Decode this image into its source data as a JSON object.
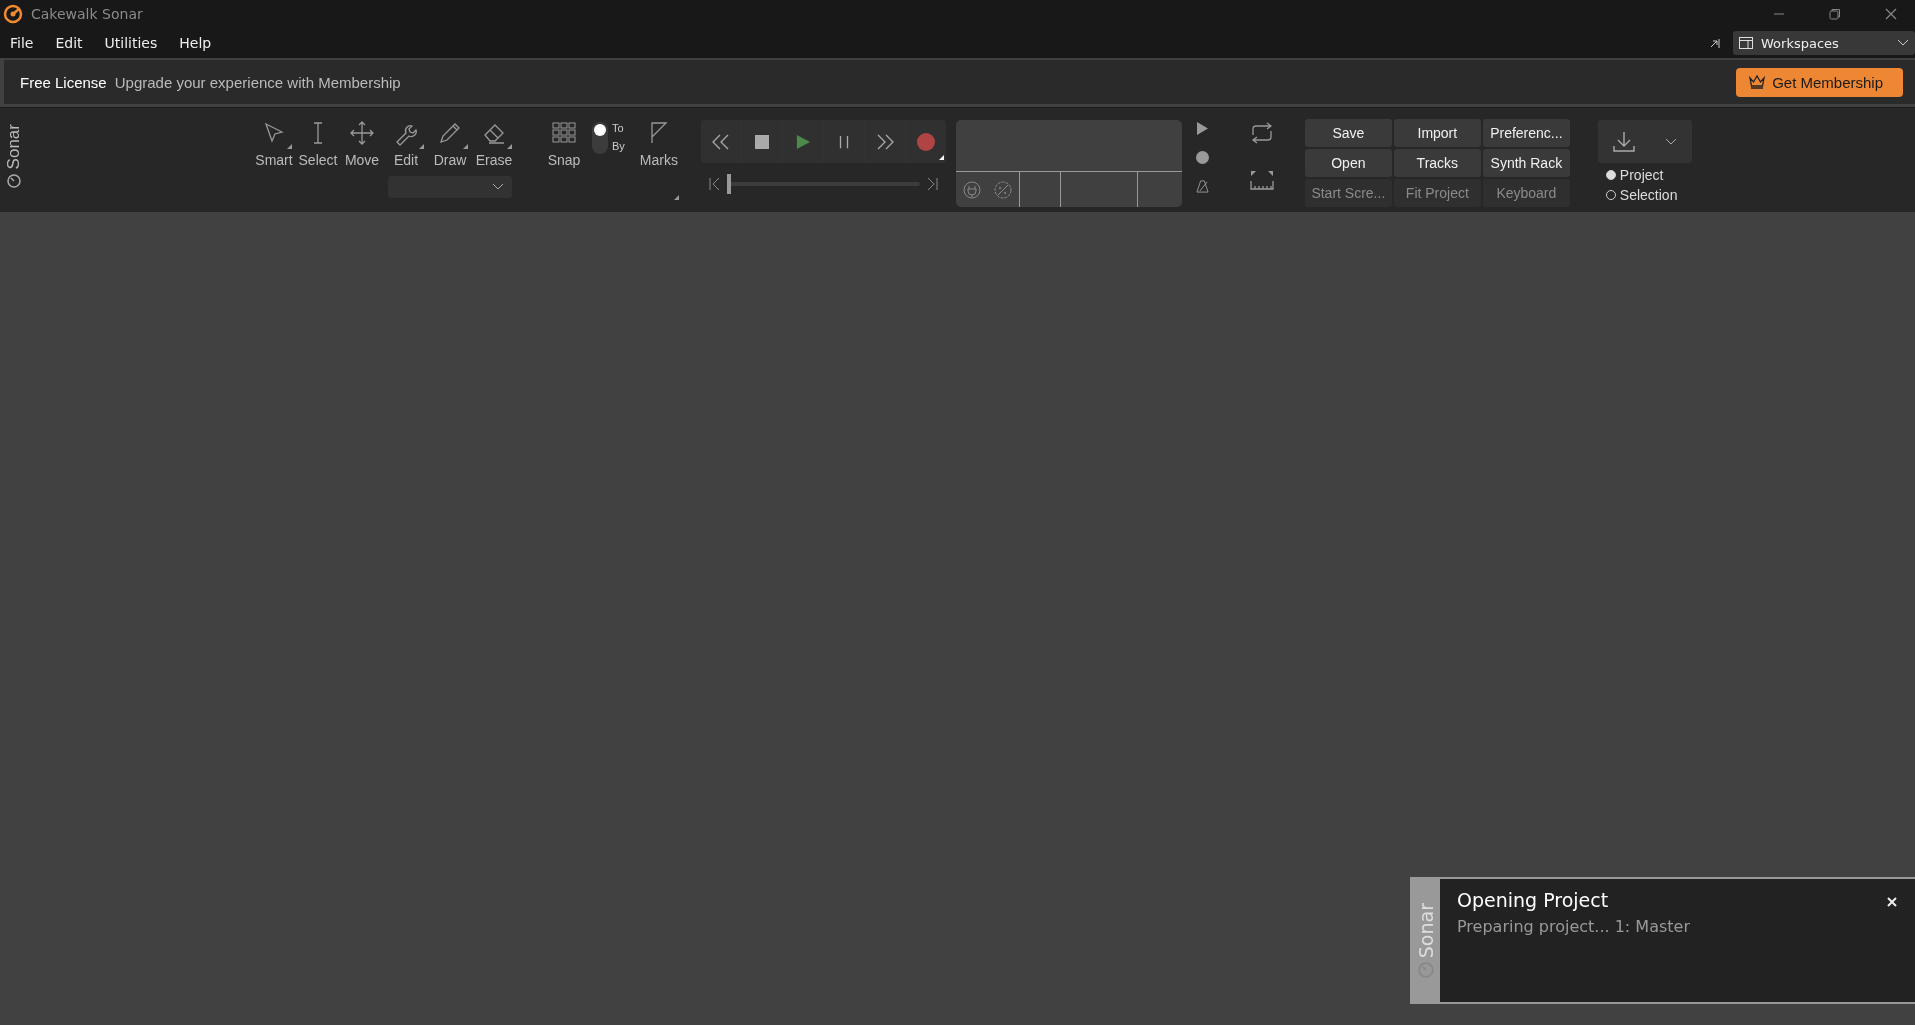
{
  "window": {
    "title": "Cakewalk Sonar"
  },
  "menu": [
    "File",
    "Edit",
    "Utilities",
    "Help"
  ],
  "workspaces": {
    "label": "Workspaces"
  },
  "banner": {
    "license": "Free License",
    "message": "Upgrade your experience with Membership",
    "button": "Get Membership"
  },
  "toolbar": {
    "side_label": "Sonar",
    "tools": [
      {
        "label": "Smart",
        "kind": "smart",
        "menu_arrow": true
      },
      {
        "label": "Select",
        "kind": "select",
        "menu_arrow": false
      },
      {
        "label": "Move",
        "kind": "move",
        "menu_arrow": false
      },
      {
        "label": "Edit",
        "kind": "edit",
        "menu_arrow": true
      },
      {
        "label": "Draw",
        "kind": "draw",
        "menu_arrow": true
      },
      {
        "label": "Erase",
        "kind": "erase",
        "menu_arrow": true
      }
    ],
    "snap": {
      "label": "Snap"
    },
    "snap_mode": [
      {
        "label": "To",
        "selected": true
      },
      {
        "label": "By",
        "selected": false
      }
    ],
    "marks": {
      "label": "Marks"
    },
    "now_slider": {
      "level": 0
    },
    "buttons": [
      {
        "label": "Save",
        "disabled": false
      },
      {
        "label": "Import",
        "disabled": false
      },
      {
        "label": "Preferenc...",
        "disabled": false
      },
      {
        "label": "Open",
        "disabled": false
      },
      {
        "label": "Tracks",
        "disabled": false
      },
      {
        "label": "Synth Rack",
        "disabled": false
      },
      {
        "label": "Start Scre...",
        "disabled": true
      },
      {
        "label": "Fit Project",
        "disabled": true
      },
      {
        "label": "Keyboard",
        "disabled": true
      }
    ],
    "export_scope": [
      {
        "label": "Project",
        "selected": true
      },
      {
        "label": "Selection",
        "selected": false
      }
    ]
  },
  "toast": {
    "side_label": "Sonar",
    "title": "Opening Project",
    "message": "Preparing project... 1: Master"
  }
}
